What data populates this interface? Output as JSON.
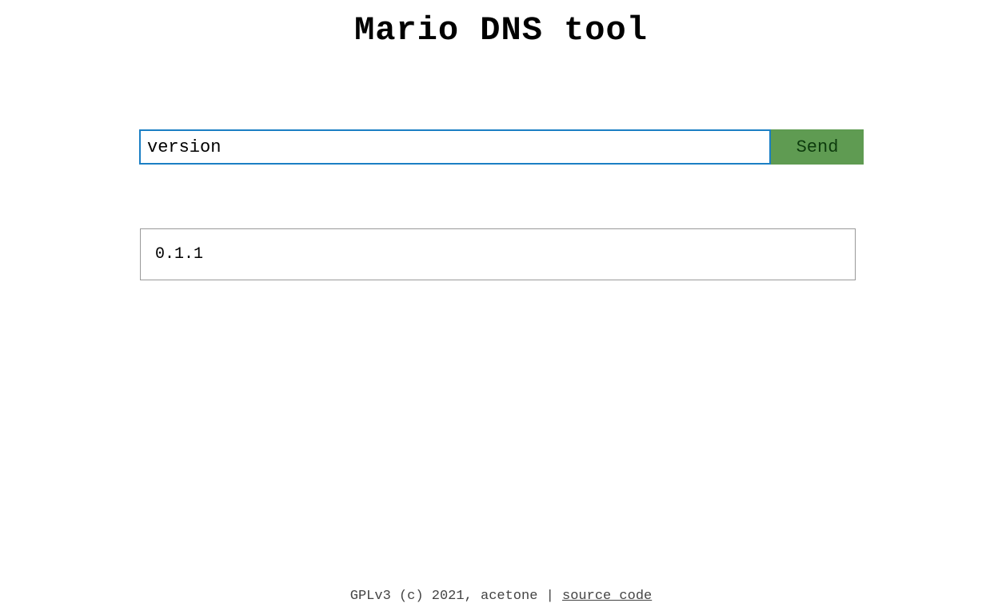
{
  "title": "Mario DNS tool",
  "form": {
    "input_value": "version",
    "send_label": "Send"
  },
  "result": "0.1.1",
  "footer": {
    "license_text": "GPLv3 (c) 2021, acetone",
    "separator": " | ",
    "link_text": "source code"
  }
}
